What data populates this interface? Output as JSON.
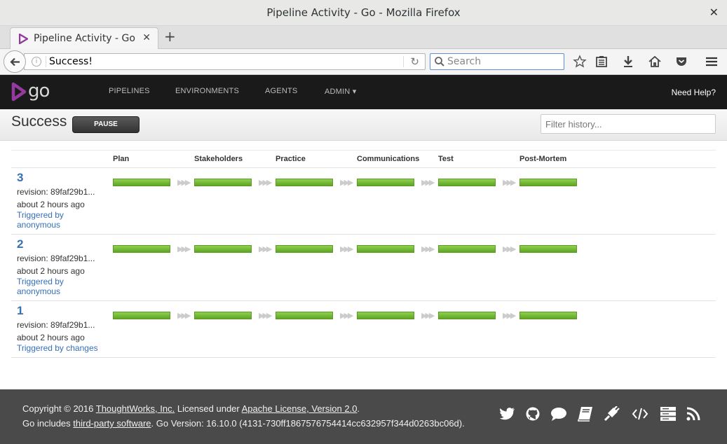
{
  "window": {
    "title": "Pipeline Activity - Go - Mozilla Firefox",
    "close_glyph": "✕"
  },
  "browser": {
    "tab_title": "Pipeline Activity - Go",
    "tab_close": "✕",
    "new_tab": "+",
    "url": "Success!",
    "search_placeholder": "Search"
  },
  "go_nav": {
    "logo_text": "go",
    "items": [
      "PIPELINES",
      "ENVIRONMENTS",
      "AGENTS",
      "ADMIN ▾"
    ],
    "help": "Need Help?"
  },
  "page": {
    "title": "Success",
    "pause_label": "PAUSE",
    "filter_placeholder": "Filter history..."
  },
  "stages": [
    "Plan",
    "Stakeholders",
    "Practice",
    "Communications",
    "Test",
    "Post-Mortem"
  ],
  "runs": [
    {
      "counter": "3",
      "revision": "revision: 89faf29b1...",
      "time": "about 2 hours ago",
      "triggered": "Triggered by anonymous",
      "status": "passed"
    },
    {
      "counter": "2",
      "revision": "revision: 89faf29b1...",
      "time": "about 2 hours ago",
      "triggered": "Triggered by anonymous",
      "status": "passed"
    },
    {
      "counter": "1",
      "revision": "revision: 89faf29b1...",
      "time": "about 2 hours ago",
      "triggered": "Triggered by changes",
      "status": "passed"
    }
  ],
  "footer": {
    "copyright_prefix": "Copyright © 2016 ",
    "company_link": "ThoughtWorks, Inc.",
    "licensed_text": " Licensed under ",
    "license_link": "Apache License, Version 2.0",
    "period": ".",
    "includes_prefix": "Go includes ",
    "thirdparty_link": "third-party software",
    "version_text": ". Go Version: 16.10.0 (4131-730ff1867576754414cc632957f344d0263bc06d).",
    "icons": [
      "twitter-icon",
      "github-icon",
      "chat-icon",
      "book-icon",
      "plugin-icon",
      "code-icon",
      "server-icon",
      "rss-icon"
    ]
  },
  "colors": {
    "accent": "#3670b8",
    "passed": "#6db33f",
    "header_bg": "#1a1a1a",
    "footer_bg": "#4a4a4a",
    "brand": "#943a9e"
  }
}
